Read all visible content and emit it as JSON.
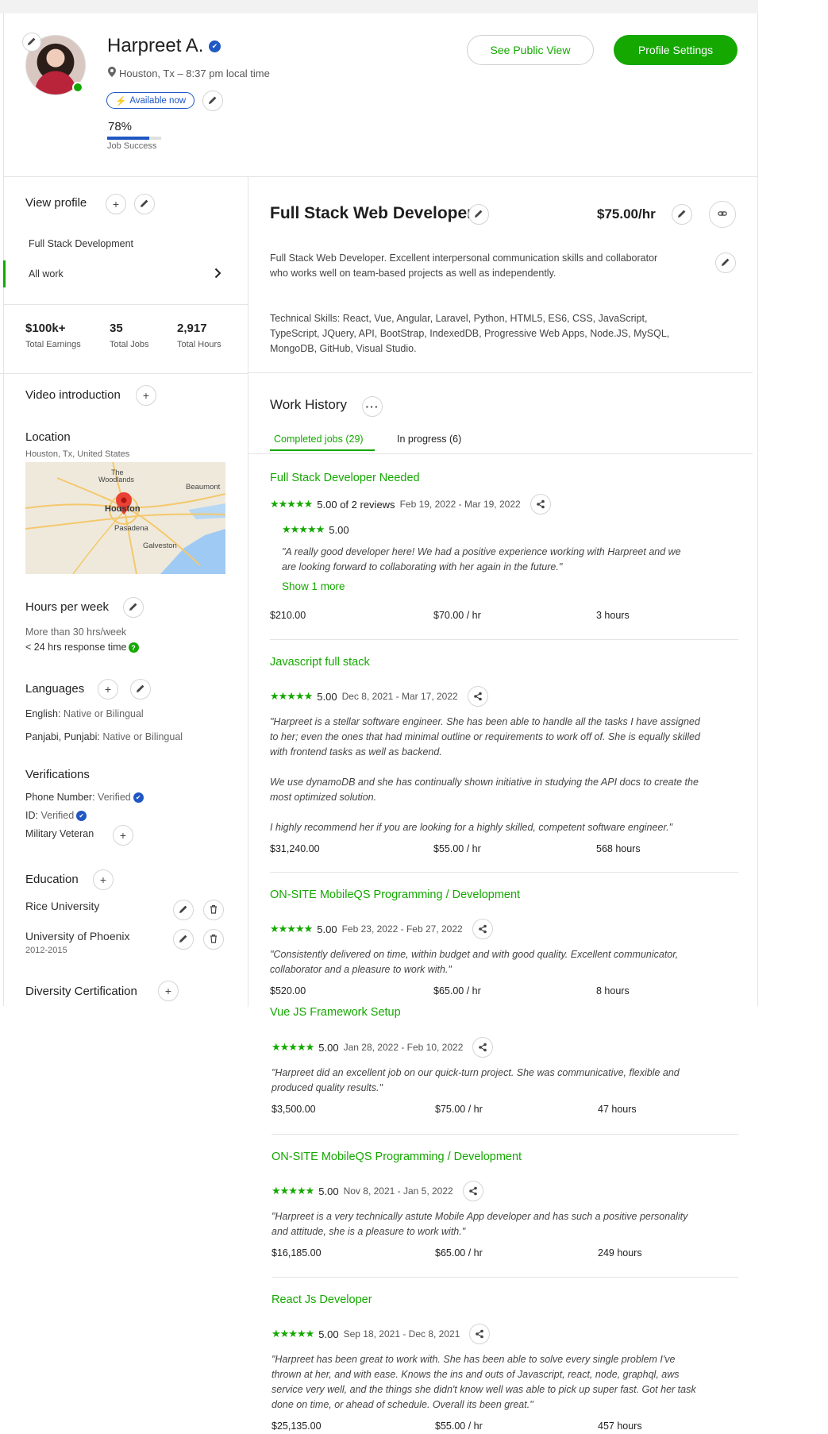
{
  "profile": {
    "name": "Harpreet A.",
    "location": "Houston, Tx – 8:37 pm local time",
    "availability": "Available now",
    "job_success_value": "78%",
    "job_success_fraction": 0.78,
    "job_success_label": "Job Success"
  },
  "actions": {
    "public_view": "See Public View",
    "settings": "Profile Settings"
  },
  "sidebar": {
    "view_profile": "View profile",
    "specialty": "Full Stack Development",
    "all_work": "All work",
    "stats": [
      {
        "value": "$100k+",
        "label": "Total Earnings"
      },
      {
        "value": "35",
        "label": "Total Jobs"
      },
      {
        "value": "2,917",
        "label": "Total Hours"
      }
    ],
    "video_intro": "Video introduction",
    "location_title": "Location",
    "location_value": "Houston, Tx, United States",
    "map_labels": [
      "The Woodlands",
      "Beaumont",
      "Houston",
      "Pasadena",
      "Galveston"
    ],
    "hours_title": "Hours per week",
    "hours_value": "More than 30 hrs/week",
    "response_time": "< 24 hrs response time",
    "languages_title": "Languages",
    "languages": [
      {
        "name": "English:",
        "level": "Native or Bilingual"
      },
      {
        "name": "Panjabi, Punjabi:",
        "level": "Native or Bilingual"
      }
    ],
    "verifications_title": "Verifications",
    "phone": {
      "label": "Phone Number:",
      "value": "Verified"
    },
    "id": {
      "label": "ID:",
      "value": "Verified"
    },
    "military": "Military Veteran",
    "education_title": "Education",
    "education": [
      {
        "school": "Rice University",
        "years": ""
      },
      {
        "school": "University of Phoenix",
        "years": "2012-2015"
      }
    ],
    "diversity": "Diversity Certification"
  },
  "main": {
    "title": "Full Stack Web Developer",
    "rate": "$75.00/hr",
    "overview_lines": [
      "Full Stack Web Developer. Excellent interpersonal communication skills and collaborator",
      "who works well on team-based projects as well as independently."
    ],
    "skills_lines": [
      "Technical Skills: React, Vue, Angular, Laravel, Python, HTML5, ES6, CSS, JavaScript,",
      "TypeScript, JQuery, API, BootStrap, IndexedDB, Progressive Web Apps, Node.JS, MySQL,",
      "MongoDB, GitHub, Visual Studio."
    ],
    "work_history_title": "Work History",
    "tabs": [
      "Completed jobs (29)",
      "In progress (6)"
    ]
  },
  "jobs": [
    {
      "title": "Full Stack Developer Needed",
      "score": "5.00 of 2 reviews",
      "dates": "Feb 19, 2022 - Mar 19, 2022",
      "sub_score": "5.00",
      "quote": [
        "\"A really good developer here! We had a positive experience working with Harpreet and we",
        "are looking forward to collaborating with her again in the future.\""
      ],
      "show_more": "Show 1 more",
      "earned": "$210.00",
      "rate": "$70.00 / hr",
      "hours": "3 hours"
    },
    {
      "title": "Javascript full stack",
      "score": "5.00",
      "dates": "Dec 8, 2021 - Mar 17, 2022",
      "quote": [
        "\"Harpreet is a stellar software engineer. She has been able to handle all the tasks I have assigned",
        "to her; even the ones that had minimal outline or requirements to work off of. She is equally skilled",
        "with frontend tasks as well as backend.",
        "",
        "We use dynamoDB and she has continually shown initiative in studying the API docs to create the",
        "most optimized solution.",
        "",
        "I highly recommend her if you are looking for a highly skilled, competent software engineer.\""
      ],
      "earned": "$31,240.00",
      "rate": "$55.00 / hr",
      "hours": "568 hours"
    },
    {
      "title": "ON-SITE MobileQS Programming / Development",
      "score": "5.00",
      "dates": "Feb 23, 2022 - Feb 27, 2022",
      "quote": [
        "\"Consistently delivered on time, within budget and with good quality. Excellent communicator,",
        "collaborator and a pleasure to work with.\""
      ],
      "earned": "$520.00",
      "rate": "$65.00 / hr",
      "hours": "8 hours"
    },
    {
      "title": "Vue JS Framework Setup",
      "score": "5.00",
      "dates": "Jan 28, 2022 - Feb 10, 2022",
      "quote": [
        "\"Harpreet did an excellent job on our quick-turn project. She was communicative, flexible and",
        "produced quality results.\""
      ],
      "earned": "$3,500.00",
      "rate": "$75.00 / hr",
      "hours": "47 hours"
    },
    {
      "title": "ON-SITE MobileQS Programming / Development",
      "score": "5.00",
      "dates": "Nov 8, 2021 - Jan 5, 2022",
      "quote": [
        "\"Harpreet is a very technically astute Mobile App developer and has such a positive personality",
        "and attitude, she is a pleasure to work with.\""
      ],
      "earned": "$16,185.00",
      "rate": "$65.00 / hr",
      "hours": "249 hours"
    },
    {
      "title": "React Js Developer",
      "score": "5.00",
      "dates": "Sep 18, 2021 - Dec 8, 2021",
      "quote": [
        "\"Harpreet has been great to work with. She has been able to solve every single problem I've",
        "thrown at her, and with ease. Knows the ins and outs of Javascript, react, node, graphql, aws",
        "service very well, and the things she didn't know well was able to pick up super fast. Got her task",
        "done on time, or ahead of schedule. Overall its been great.\""
      ],
      "earned": "$25,135.00",
      "rate": "$55.00 / hr",
      "hours": "457 hours"
    }
  ],
  "colors": {
    "accent": "#14a800",
    "brand_blue": "#1f57c3"
  },
  "icons": [
    "pencil-icon",
    "plus-icon",
    "location-pin-icon",
    "bolt-icon",
    "verified-icon",
    "link-icon",
    "share-icon",
    "trash-icon",
    "chevron-right-icon",
    "more-icon",
    "help-icon"
  ]
}
